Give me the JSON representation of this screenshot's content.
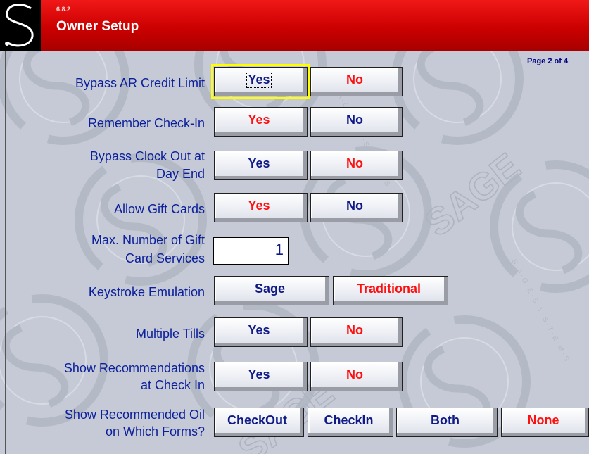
{
  "app": {
    "version": "6.8.2",
    "title": "Owner Setup",
    "page_indicator": "Page 2 of 4",
    "watermark_text": "SAGE",
    "watermark_ring_text": "S · A · G · E · S · Y · S · T · E · M · S"
  },
  "colors": {
    "titlebar": "#cc0000",
    "background": "#c5cad6",
    "label_blue": "#0b1f9a",
    "active_red": "#ff1010",
    "inactive_navy": "#0f1a86",
    "focus_outline": "#ffff00"
  },
  "rows": {
    "bypass_ar": {
      "label_line1": "Bypass AR Credit Limit",
      "yes": "Yes",
      "no": "No",
      "selected": "No"
    },
    "remember_checkin": {
      "label_line1": "Remember Check-In",
      "yes": "Yes",
      "no": "No",
      "selected": "Yes"
    },
    "bypass_clock": {
      "label_line1": "Bypass Clock Out at",
      "label_line2": "Day End",
      "yes": "Yes",
      "no": "No",
      "selected": "No"
    },
    "gift_cards": {
      "label_line1": "Allow Gift Cards",
      "yes": "Yes",
      "no": "No",
      "selected": "Yes"
    },
    "max_gift": {
      "label_line1": "Max. Number of Gift",
      "label_line2": "Card Services",
      "value": "1"
    },
    "keystroke": {
      "label_line1": "Keystroke Emulation",
      "sage": "Sage",
      "traditional": "Traditional",
      "selected": "Traditional"
    },
    "multiple_tills": {
      "label_line1": "Multiple Tills",
      "yes": "Yes",
      "no": "No",
      "selected": "No"
    },
    "show_recommendations": {
      "label_line1": "Show Recommendations",
      "label_line2": "at Check In",
      "yes": "Yes",
      "no": "No",
      "selected": "No"
    },
    "recommended_oil": {
      "label_line1": "Show Recommended Oil",
      "label_line2": "on Which Forms?",
      "checkout": "CheckOut",
      "checkin": "CheckIn",
      "both": "Both",
      "none": "None",
      "selected": "None"
    }
  }
}
